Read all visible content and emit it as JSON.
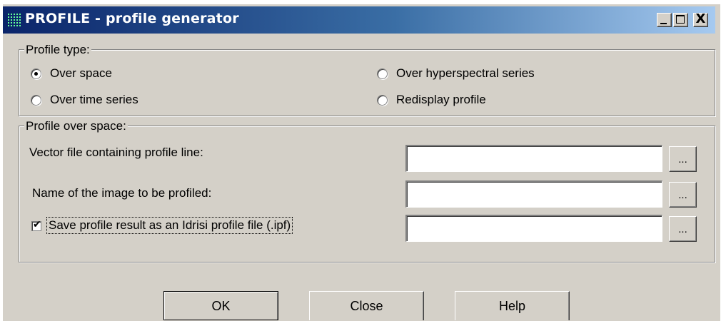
{
  "window": {
    "title": "PROFILE - profile generator",
    "caption_buttons": {
      "minimize": "minimize-icon",
      "maximize": "maximize-icon",
      "close": "X"
    },
    "titlebar_colors": [
      "#0a246a",
      "#a6caf0"
    ]
  },
  "profile_type": {
    "legend": "Profile type:",
    "options": [
      {
        "label": "Over space",
        "selected": true
      },
      {
        "label": "Over time series",
        "selected": false
      },
      {
        "label": "Over hyperspectral series",
        "selected": false
      },
      {
        "label": "Redisplay profile",
        "selected": false
      }
    ]
  },
  "profile_over_space": {
    "legend": "Profile over space:",
    "vector_label": "Vector file containing profile line:",
    "vector_value": "",
    "image_label": "Name of the image to be profiled:",
    "image_value": "",
    "save_label": "Save profile result as an Idrisi profile file (.ipf)",
    "save_checked": true,
    "save_value": "",
    "browse_label": "..."
  },
  "buttons": {
    "ok": "OK",
    "close": "Close",
    "help": "Help"
  }
}
